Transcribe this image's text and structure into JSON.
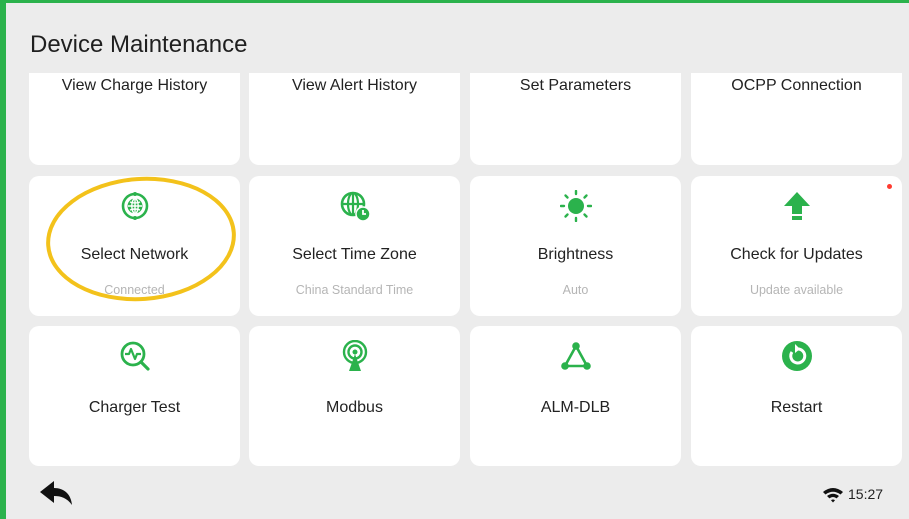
{
  "header": {
    "title": "Device Maintenance"
  },
  "tiles": {
    "charge_history": {
      "label": "View Charge History",
      "icon": "history-icon"
    },
    "alert_history": {
      "label": "View Alert History",
      "icon": "alert-icon"
    },
    "set_parameters": {
      "label": "Set Parameters",
      "icon": "settings-icon"
    },
    "ocpp": {
      "label": "OCPP Connection",
      "icon": "ocpp-icon"
    },
    "select_network": {
      "label": "Select Network",
      "subtitle": "Connected",
      "icon": "globe-icon"
    },
    "time_zone": {
      "label": "Select Time Zone",
      "subtitle": "China Standard Time",
      "icon": "globe-clock-icon"
    },
    "brightness": {
      "label": "Brightness",
      "subtitle": "Auto",
      "icon": "sun-icon"
    },
    "updates": {
      "label": "Check for Updates",
      "subtitle": "Update available",
      "icon": "arrow-up-icon",
      "badge": "red-dot"
    },
    "charger_test": {
      "label": "Charger Test",
      "icon": "test-search-icon"
    },
    "modbus": {
      "label": "Modbus",
      "icon": "broadcast-icon"
    },
    "alm_dlb": {
      "label": "ALM-DLB",
      "icon": "triangle-nodes-icon"
    },
    "restart": {
      "label": "Restart",
      "icon": "restart-icon"
    }
  },
  "status_bar": {
    "time": "15:27",
    "wifi_icon": "wifi-icon",
    "back_icon": "back-arrow-icon"
  },
  "colors": {
    "accent": "#2bb24c",
    "highlight_ring": "#f3c21b",
    "badge": "#ff3b30"
  }
}
